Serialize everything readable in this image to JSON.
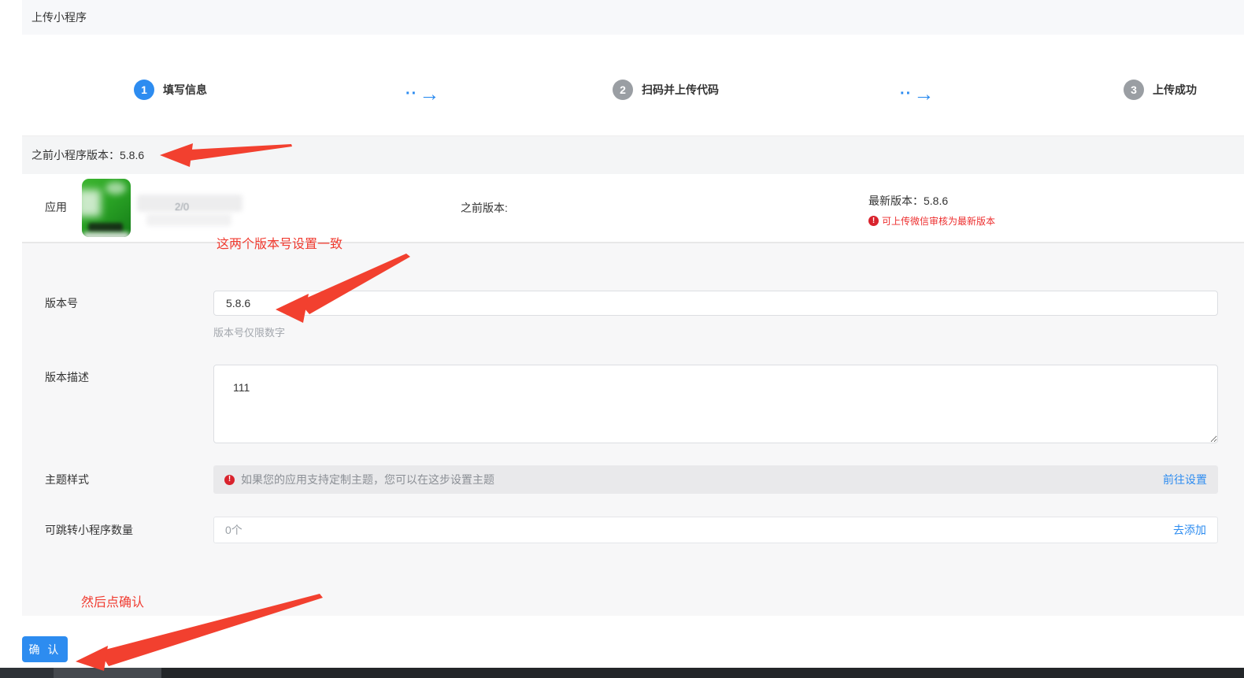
{
  "header": {
    "title": "上传小程序"
  },
  "steps": {
    "items": [
      {
        "num": "1",
        "label": "填写信息"
      },
      {
        "num": "2",
        "label": "扫码并上传代码"
      },
      {
        "num": "3",
        "label": "上传成功"
      }
    ],
    "arrow_dots": "··",
    "arrow_glyph": "→"
  },
  "prev_version_bar": {
    "text": "之前小程序版本：5.8.6"
  },
  "app_row": {
    "app_label": "应用",
    "censored_fragment": "2/0",
    "prev_version_label": "之前版本:",
    "latest_version_text": "最新版本：5.8.6",
    "warning_mark": "!",
    "latest_version_note": "可上传微信审核为最新版本"
  },
  "form": {
    "version": {
      "label": "版本号",
      "value": "5.8.6",
      "hint": "版本号仅限数字"
    },
    "description": {
      "label": "版本描述",
      "value": "111"
    },
    "theme": {
      "label": "主题样式",
      "warning_mark": "!",
      "notice": "如果您的应用支持定制主题，您可以在这步设置主题",
      "link_label": "前往设置"
    },
    "jumpable": {
      "label": "可跳转小程序数量",
      "value": "0个",
      "link_label": "去添加"
    }
  },
  "annotations": {
    "version_note": "这两个版本号设置一致",
    "confirm_note": "然后点确认",
    "annotation_red": "#f2402f"
  },
  "footer": {
    "confirm_label": "确 认"
  },
  "colors": {
    "accent_blue": "#2d8cf0",
    "warning_red": "#ed2f2f",
    "step_pending_gray": "#9a9ea3"
  }
}
